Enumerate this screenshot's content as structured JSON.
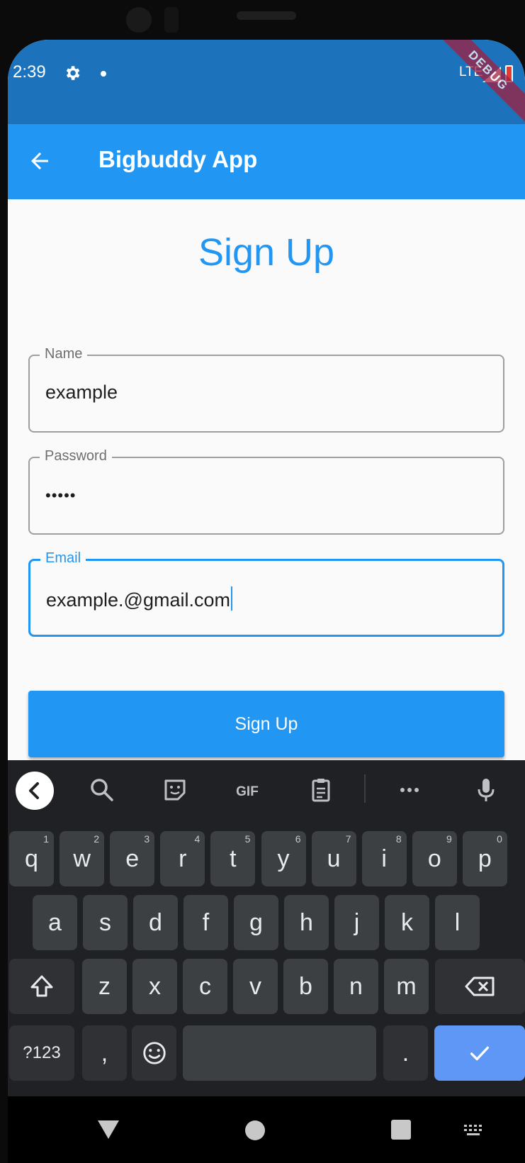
{
  "status_bar": {
    "time": "2:39",
    "network": "LTE",
    "debug_banner": "DEBUG"
  },
  "app_bar": {
    "title": "Bigbuddy App"
  },
  "form": {
    "heading": "Sign Up",
    "fields": [
      {
        "label": "Name",
        "value": "example"
      },
      {
        "label": "Password",
        "value": "•••••"
      },
      {
        "label": "Email",
        "value": "example.@gmail.com"
      }
    ],
    "submit_label": "Sign Up"
  },
  "keyboard": {
    "toolbar": {
      "gif_label": "GIF"
    },
    "row1": [
      {
        "key": "q",
        "hint": "1"
      },
      {
        "key": "w",
        "hint": "2"
      },
      {
        "key": "e",
        "hint": "3"
      },
      {
        "key": "r",
        "hint": "4"
      },
      {
        "key": "t",
        "hint": "5"
      },
      {
        "key": "y",
        "hint": "6"
      },
      {
        "key": "u",
        "hint": "7"
      },
      {
        "key": "i",
        "hint": "8"
      },
      {
        "key": "o",
        "hint": "9"
      },
      {
        "key": "p",
        "hint": "0"
      }
    ],
    "row2": [
      "a",
      "s",
      "d",
      "f",
      "g",
      "h",
      "j",
      "k",
      "l"
    ],
    "row3": [
      "z",
      "x",
      "c",
      "v",
      "b",
      "n",
      "m"
    ],
    "symbols_label": "?123",
    "comma_label": ",",
    "period_label": "."
  },
  "colors": {
    "primary": "#2196f3",
    "status_bar": "#1c72bb",
    "keyboard_bg": "#202124",
    "key_bg": "#3c4043",
    "enter_key": "#5e97f6"
  }
}
